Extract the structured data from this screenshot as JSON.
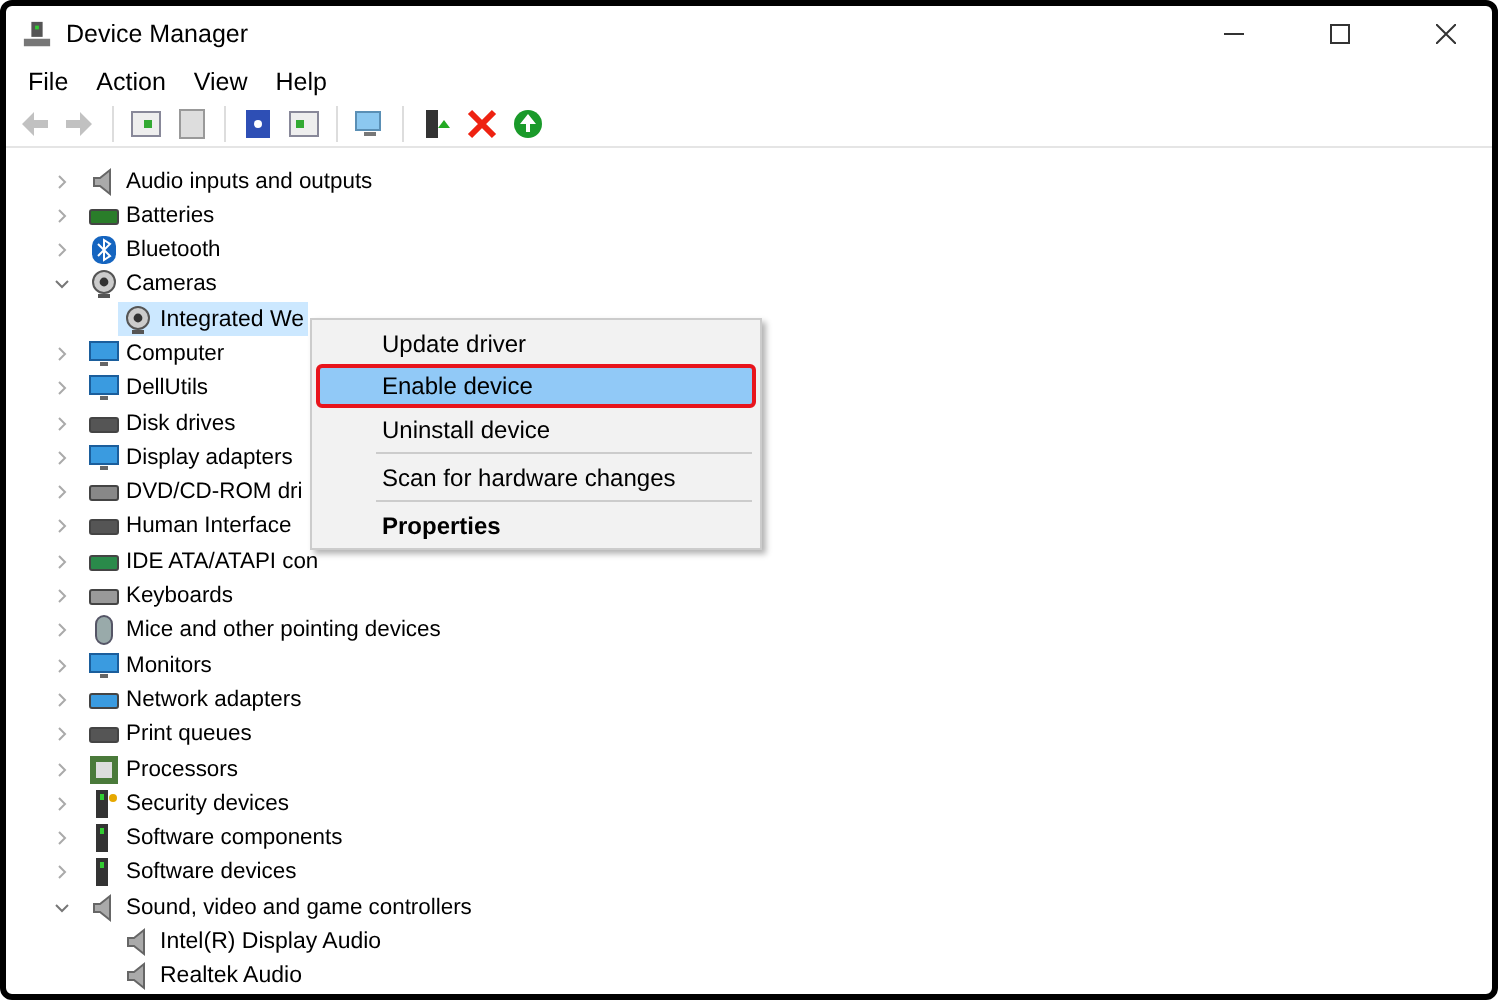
{
  "window": {
    "title": "Device Manager"
  },
  "menu_bar": [
    "File",
    "Action",
    "View",
    "Help"
  ],
  "toolbar": [
    {
      "disabled": true
    },
    {
      "disabled": true
    },
    {
      "disabled": false
    },
    {
      "disabled": false
    },
    {
      "disabled": false
    },
    {
      "disabled": false
    },
    {
      "disabled": false
    },
    {
      "disabled": false
    },
    {
      "disabled": false
    },
    {
      "disabled": false
    }
  ],
  "tree": [
    {
      "label": "Audio inputs and outputs",
      "expanded": false
    },
    {
      "label": "Batteries",
      "expanded": false
    },
    {
      "label": "Bluetooth",
      "expanded": false
    },
    {
      "label": "Cameras",
      "expanded": true,
      "children": [
        {
          "label": "Integrated We",
          "selected": true
        }
      ]
    },
    {
      "label": "Computer",
      "expanded": false
    },
    {
      "label": "DellUtils",
      "expanded": false
    },
    {
      "label": "Disk drives",
      "expanded": false
    },
    {
      "label": "Display adapters",
      "expanded": false
    },
    {
      "label": "DVD/CD-ROM dri",
      "expanded": false
    },
    {
      "label": "Human Interface",
      "expanded": false
    },
    {
      "label": "IDE ATA/ATAPI con",
      "expanded": false
    },
    {
      "label": "Keyboards",
      "expanded": false
    },
    {
      "label": "Mice and other pointing devices",
      "expanded": false
    },
    {
      "label": "Monitors",
      "expanded": false
    },
    {
      "label": "Network adapters",
      "expanded": false
    },
    {
      "label": "Print queues",
      "expanded": false
    },
    {
      "label": "Processors",
      "expanded": false
    },
    {
      "label": "Security devices",
      "expanded": false
    },
    {
      "label": "Software components",
      "expanded": false
    },
    {
      "label": "Software devices",
      "expanded": false
    },
    {
      "label": "Sound, video and game controllers",
      "expanded": true,
      "children": [
        {
          "label": "Intel(R) Display Audio",
          "selected": false
        },
        {
          "label": "Realtek Audio",
          "selected": false
        }
      ]
    }
  ],
  "context_menu": {
    "groups": [
      [
        {
          "label": "Update driver",
          "selected": false,
          "default": false
        },
        {
          "label": "Enable device",
          "selected": true,
          "default": false
        },
        {
          "label": "Uninstall device",
          "selected": false,
          "default": false
        }
      ],
      [
        {
          "label": "Scan for hardware changes",
          "selected": false,
          "default": false
        }
      ],
      [
        {
          "label": "Properties",
          "selected": false,
          "default": true
        }
      ]
    ]
  }
}
